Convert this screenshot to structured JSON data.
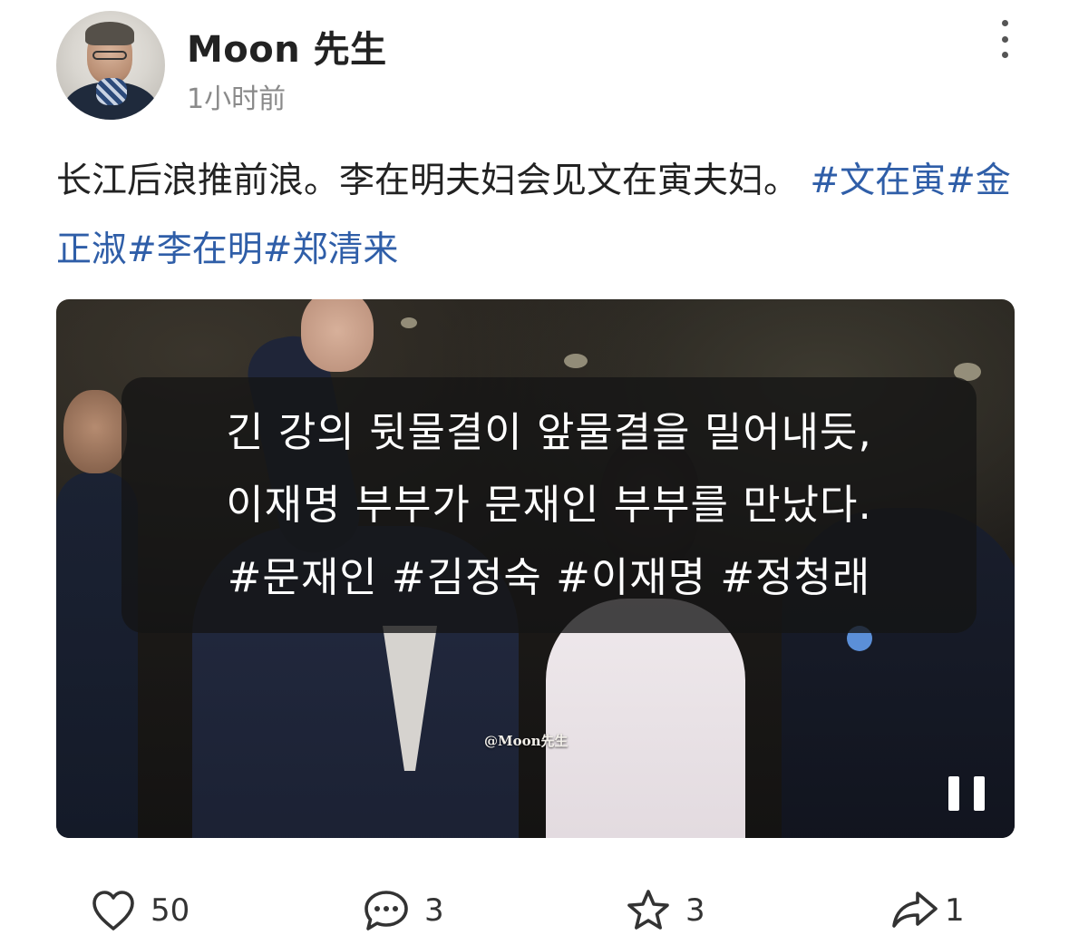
{
  "author": {
    "name": "Moon 先生",
    "time": "1小时前",
    "avatar_icon": "user-avatar"
  },
  "post": {
    "text": "长江后浪推前浪。李在明夫妇会见文在寅夫妇。 ",
    "hashtags": [
      "#文在寅",
      "#金正淑",
      "#李在明",
      "#郑清来"
    ]
  },
  "video": {
    "caption_lines": [
      "긴 강의 뒷물결이 앞물결을 밀어내듯,",
      "이재명 부부가 문재인 부부를 만났다.",
      "#문재인 #김정숙 #이재명 #정청래"
    ],
    "watermark": "@Moon先生",
    "state_icon": "pause-icon"
  },
  "actions": {
    "like": {
      "count": "50",
      "icon": "heart-icon"
    },
    "comment": {
      "count": "3",
      "icon": "comment-icon"
    },
    "favorite": {
      "count": "3",
      "icon": "star-icon"
    },
    "share": {
      "count": "1",
      "icon": "share-icon"
    }
  },
  "colors": {
    "hashtag": "#2f5ea8",
    "text": "#222222",
    "muted": "#8a8a8a"
  }
}
